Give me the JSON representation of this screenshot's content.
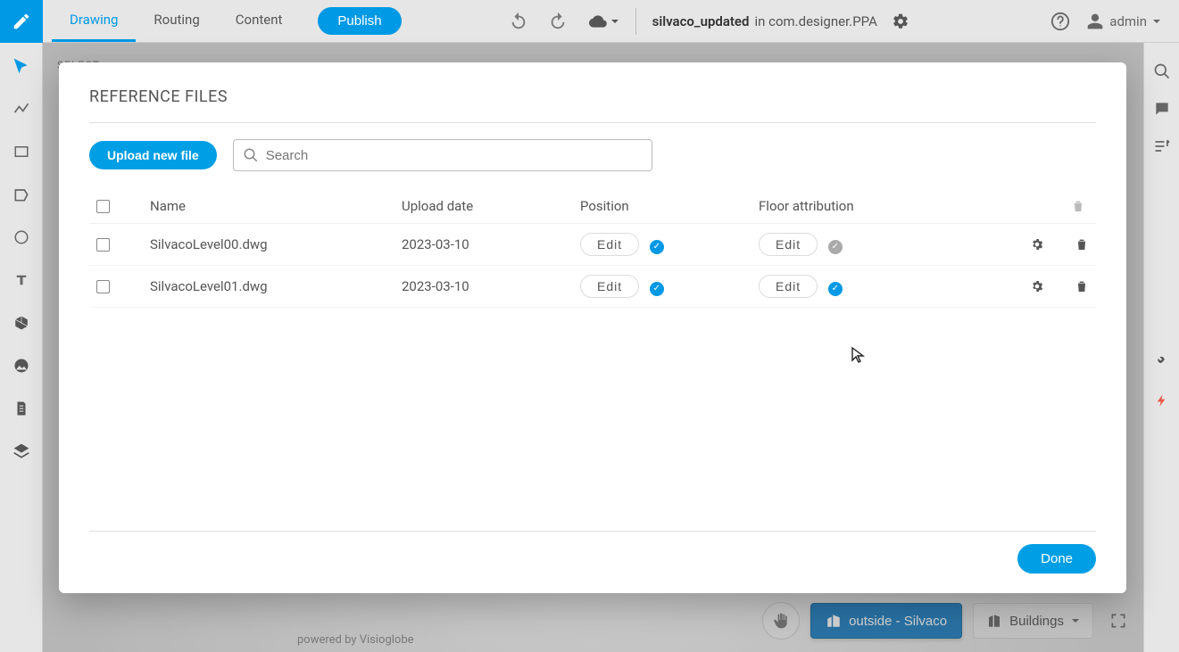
{
  "topbar": {
    "tabs": {
      "drawing": "Drawing",
      "routing": "Routing",
      "content": "Content"
    },
    "publish": "Publish",
    "project_name": "silvaco_updated",
    "project_suffix": " in com.designer.PPA",
    "user": "admin"
  },
  "sidebar": {
    "select_hint": "SELECT"
  },
  "modal": {
    "title": "REFERENCE FILES",
    "upload_btn": "Upload new file",
    "search_placeholder": "Search",
    "columns": {
      "name": "Name",
      "upload_date": "Upload date",
      "position": "Position",
      "floor": "Floor attribution"
    },
    "edit_label": "Edit",
    "done_label": "Done",
    "rows": [
      {
        "name": "SilvacoLevel00.dwg",
        "date": "2023-03-10",
        "position_ok": true,
        "floor_ok": false
      },
      {
        "name": "SilvacoLevel01.dwg",
        "date": "2023-03-10",
        "position_ok": true,
        "floor_ok": true
      }
    ]
  },
  "bottom": {
    "hand_title": "Pan",
    "outside_label": "outside - Silvaco",
    "buildings_label": "Buildings",
    "powered": "powered by Visioglobe"
  }
}
